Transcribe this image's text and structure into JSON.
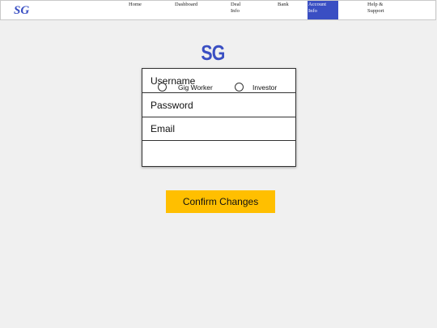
{
  "topbar": {
    "brand": "SG",
    "nav": [
      {
        "label": "Home"
      },
      {
        "label": "Dashboard"
      },
      {
        "label": "Deal Info"
      },
      {
        "label": "Bank"
      },
      {
        "label": "Account Info",
        "active": true
      },
      {
        "label": "Help & Support"
      }
    ]
  },
  "logo": "SG",
  "form": {
    "username_placeholder": "Username",
    "password_placeholder": "Password",
    "email_placeholder": "Email",
    "role_options": [
      {
        "label": "Gig Worker",
        "selected": false
      },
      {
        "label": "Investor",
        "selected": false
      }
    ]
  },
  "confirm_label": "Confirm Changes",
  "colors": {
    "brand_blue": "#3a4fc3",
    "accent_yellow": "#ffbf00",
    "background": "#f0f0f0"
  }
}
